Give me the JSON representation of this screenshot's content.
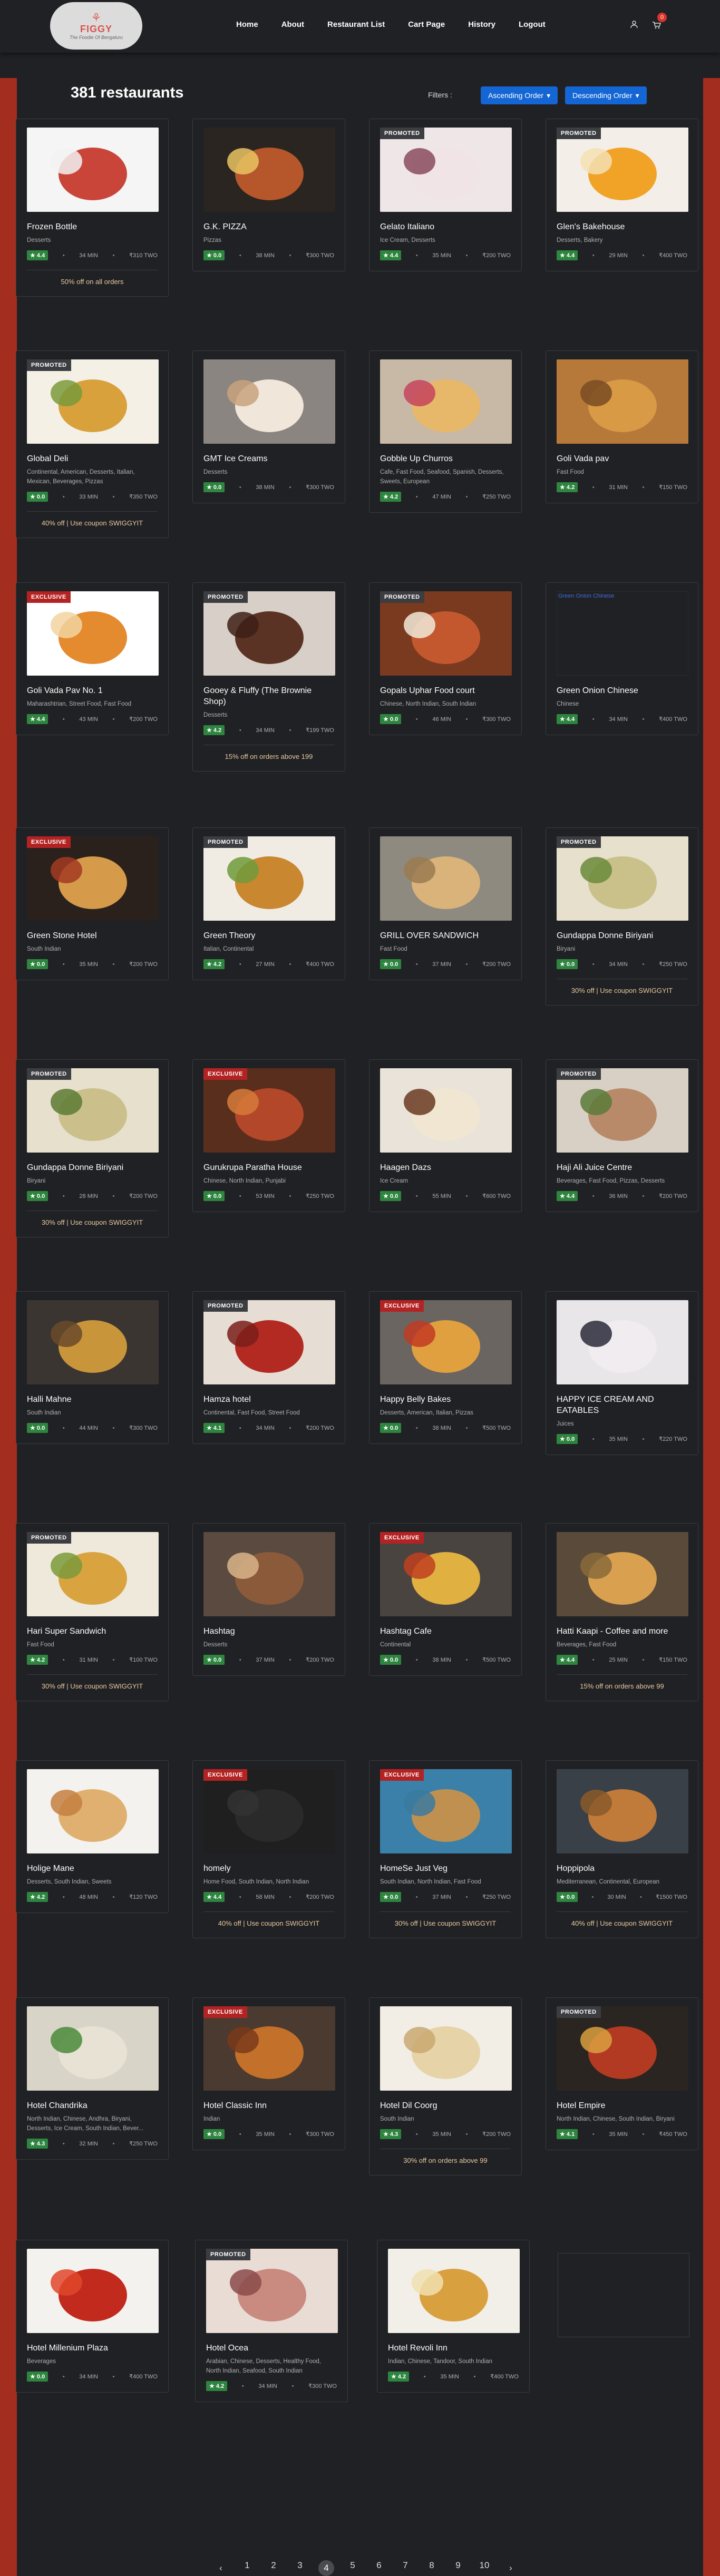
{
  "header": {
    "brand": "FIGGY",
    "tagline": "The Foodie Of Bengaluru",
    "nav": [
      "Home",
      "About",
      "Restaurant List",
      "Cart Page",
      "History",
      "Logout"
    ],
    "cart_count": "0"
  },
  "toolbar": {
    "count": "381 restaurants",
    "filters_label": "Filters :",
    "asc": "Ascending Order",
    "desc": "Descending Order"
  },
  "restaurants": [
    {
      "name": "Frozen Bottle",
      "cuisine": "Desserts",
      "rating": "4.4",
      "time": "34 MIN",
      "cost": "₹310 TWO",
      "tag": "",
      "offer": "50% off on all orders",
      "c1": "#c9453a",
      "c2": "#f2f2f2",
      "bg": "#f5f5f5"
    },
    {
      "name": "G.K. PIZZA",
      "cuisine": "Pizzas",
      "rating": "0.0",
      "time": "38 MIN",
      "cost": "₹300 TWO",
      "tag": "",
      "offer": "",
      "c1": "#b5562b",
      "c2": "#e9c463",
      "bg": "#2a2520"
    },
    {
      "name": "Gelato Italiano",
      "cuisine": "Ice Cream, Desserts",
      "rating": "4.4",
      "time": "35 MIN",
      "cost": "₹200 TWO",
      "tag": "PROMOTED",
      "offer": "",
      "c1": "#f0e4e6",
      "c2": "#8a4b5e",
      "bg": "#efe6e8"
    },
    {
      "name": "Glen's Bakehouse",
      "cuisine": "Desserts, Bakery",
      "rating": "4.4",
      "time": "29 MIN",
      "cost": "₹400 TWO",
      "tag": "PROMOTED",
      "offer": "",
      "c1": "#f0a327",
      "c2": "#f5e1b4",
      "bg": "#f3efe8"
    },
    {
      "name": "Global Deli",
      "cuisine": "Continental, American, Desserts, Italian, Mexican, Beverages, Pizzas",
      "rating": "0.0",
      "time": "33 MIN",
      "cost": "₹350 TWO",
      "tag": "PROMOTED",
      "offer": "40% off | Use coupon SWIGGYIT",
      "c1": "#d8a13b",
      "c2": "#7a9a3c",
      "bg": "#f4f0e5"
    },
    {
      "name": "GMT Ice Creams",
      "cuisine": "Desserts",
      "rating": "0.0",
      "time": "38 MIN",
      "cost": "₹300 TWO",
      "tag": "",
      "offer": "",
      "c1": "#f0e6da",
      "c2": "#c8a27d",
      "bg": "#8a8580"
    },
    {
      "name": "Gobble Up Churros",
      "cuisine": "Cafe, Fast Food, Seafood, Spanish, Desserts, Sweets, European",
      "rating": "4.2",
      "time": "47 MIN",
      "cost": "₹250 TWO",
      "tag": "",
      "offer": "",
      "c1": "#e8b86a",
      "c2": "#c5435c",
      "bg": "#c8b8a6"
    },
    {
      "name": "Goli Vada pav",
      "cuisine": "Fast Food",
      "rating": "4.2",
      "time": "31 MIN",
      "cost": "₹150 TWO",
      "tag": "",
      "offer": "",
      "c1": "#d89a45",
      "c2": "#7a4b23",
      "bg": "#b6793a"
    },
    {
      "name": "Goli Vada Pav No. 1",
      "cuisine": "Maharashtrian, Street Food, Fast Food",
      "rating": "4.4",
      "time": "43 MIN",
      "cost": "₹200 TWO",
      "tag": "EXCLUSIVE",
      "offer": "",
      "c1": "#e48a2f",
      "c2": "#f2d4a0",
      "bg": "#ffffff"
    },
    {
      "name": "Gooey & Fluffy (The Brownie Shop)",
      "cuisine": "Desserts",
      "rating": "4.2",
      "time": "34 MIN",
      "cost": "₹199 TWO",
      "tag": "PROMOTED",
      "offer": "15% off on orders above 199",
      "c1": "#5a3324",
      "c2": "#3e2016",
      "bg": "#d8d0c8"
    },
    {
      "name": "Gopals Uphar Food court",
      "cuisine": "Chinese, North Indian, South Indian",
      "rating": "0.0",
      "time": "46 MIN",
      "cost": "₹300 TWO",
      "tag": "PROMOTED",
      "offer": "",
      "c1": "#c3582f",
      "c2": "#f2ead8",
      "bg": "#7a3a20"
    },
    {
      "name": "Green Onion Chinese",
      "cuisine": "Chinese",
      "rating": "4.4",
      "time": "34 MIN",
      "cost": "₹400 TWO",
      "tag": "",
      "offer": "",
      "c1": "",
      "c2": "",
      "bg": "",
      "broken": "Green Onion Chinese"
    },
    {
      "name": "Green Stone Hotel",
      "cuisine": "South Indian",
      "rating": "0.0",
      "time": "35 MIN",
      "cost": "₹200 TWO",
      "tag": "EXCLUSIVE",
      "offer": "",
      "c1": "#d59a4a",
      "c2": "#a33a22",
      "bg": "#2a211c"
    },
    {
      "name": "Green Theory",
      "cuisine": "Italian, Continental",
      "rating": "4.2",
      "time": "27 MIN",
      "cost": "₹400 TWO",
      "tag": "PROMOTED",
      "offer": "",
      "c1": "#c9872f",
      "c2": "#6e9b3a",
      "bg": "#f0ece4"
    },
    {
      "name": "GRILL OVER SANDWICH",
      "cuisine": "Fast Food",
      "rating": "0.0",
      "time": "37 MIN",
      "cost": "₹200 TWO",
      "tag": "",
      "offer": "",
      "c1": "#d9b37a",
      "c2": "#9a7a50",
      "bg": "#8f8a80"
    },
    {
      "name": "Gundappa Donne Biriyani",
      "cuisine": "Biryani",
      "rating": "0.0",
      "time": "34 MIN",
      "cost": "₹250 TWO",
      "tag": "PROMOTED",
      "offer": "30% off | Use coupon SWIGGYIT",
      "c1": "#c9c08a",
      "c2": "#6a8a3a",
      "bg": "#e6e0cc"
    },
    {
      "name": "Gundappa Donne Biriyani",
      "cuisine": "Biryani",
      "rating": "0.0",
      "time": "28 MIN",
      "cost": "₹200 TWO",
      "tag": "PROMOTED",
      "offer": "30% off | Use coupon SWIGGYIT",
      "c1": "#cbbf8c",
      "c2": "#5c7a33",
      "bg": "#e6e0cc"
    },
    {
      "name": "Gurukrupa Paratha House",
      "cuisine": "Chinese, North Indian, Punjabi",
      "rating": "0.0",
      "time": "53 MIN",
      "cost": "₹250 TWO",
      "tag": "EXCLUSIVE",
      "offer": "",
      "c1": "#b3472a",
      "c2": "#d67a3a",
      "bg": "#5a2e1c"
    },
    {
      "name": "Haagen Dazs",
      "cuisine": "Ice Cream",
      "rating": "0.0",
      "time": "55 MIN",
      "cost": "₹600 TWO",
      "tag": "",
      "offer": "",
      "c1": "#f1e6d2",
      "c2": "#6a3a22",
      "bg": "#e9e3da"
    },
    {
      "name": "Haji Ali Juice Centre",
      "cuisine": "Beverages, Fast Food, Pizzas, Desserts",
      "rating": "4.4",
      "time": "36 MIN",
      "cost": "₹200 TWO",
      "tag": "PROMOTED",
      "offer": "",
      "c1": "#b88a6a",
      "c2": "#5a7a3a",
      "bg": "#d8d0c4"
    },
    {
      "name": "Halli Mahne",
      "cuisine": "South Indian",
      "rating": "0.0",
      "time": "44 MIN",
      "cost": "₹300 TWO",
      "tag": "",
      "offer": "",
      "c1": "#c9953a",
      "c2": "#6a4a2a",
      "bg": "#3a3530"
    },
    {
      "name": "Hamza hotel",
      "cuisine": "Continental, Fast Food, Street Food",
      "rating": "4.1",
      "time": "34 MIN",
      "cost": "₹200 TWO",
      "tag": "PROMOTED",
      "offer": "",
      "c1": "#b32a22",
      "c2": "#7a1f1a",
      "bg": "#e6ddd4"
    },
    {
      "name": "Happy Belly Bakes",
      "cuisine": "Desserts, American, Italian, Pizzas",
      "rating": "0.0",
      "time": "38 MIN",
      "cost": "₹500 TWO",
      "tag": "EXCLUSIVE",
      "offer": "",
      "c1": "#e0a040",
      "c2": "#c23a22",
      "bg": "#6a6560"
    },
    {
      "name": "HAPPY ICE CREAM AND EATABLES",
      "cuisine": "Juices",
      "rating": "0.0",
      "time": "35 MIN",
      "cost": "₹220 TWO",
      "tag": "",
      "offer": "",
      "c1": "#f0ecf0",
      "c2": "#2a2a3a",
      "bg": "#e9e6ea"
    },
    {
      "name": "Hari Super Sandwich",
      "cuisine": "Fast Food",
      "rating": "4.2",
      "time": "31 MIN",
      "cost": "₹100 TWO",
      "tag": "PROMOTED",
      "offer": "30% off | Use coupon SWIGGYIT",
      "c1": "#d9a440",
      "c2": "#7a9a3a",
      "bg": "#efe9dc"
    },
    {
      "name": "Hashtag",
      "cuisine": "Desserts",
      "rating": "0.0",
      "time": "37 MIN",
      "cost": "₹200 TWO",
      "tag": "",
      "offer": "",
      "c1": "#8a5a3a",
      "c2": "#d9b48a",
      "bg": "#5a4a40"
    },
    {
      "name": "Hashtag Cafe",
      "cuisine": "Continental",
      "rating": "0.0",
      "time": "38 MIN",
      "cost": "₹500 TWO",
      "tag": "EXCLUSIVE",
      "offer": "",
      "c1": "#e0b040",
      "c2": "#c04020",
      "bg": "#4a4440"
    },
    {
      "name": "Hatti Kaapi - Coffee and more",
      "cuisine": "Beverages, Fast Food",
      "rating": "4.4",
      "time": "25 MIN",
      "cost": "₹150 TWO",
      "tag": "",
      "offer": "15% off on orders above 99",
      "c1": "#d9a050",
      "c2": "#8a6a3a",
      "bg": "#5a4a3a"
    },
    {
      "name": "Holige Mane",
      "cuisine": "Desserts, South Indian, Sweets",
      "rating": "4.2",
      "time": "48 MIN",
      "cost": "₹120 TWO",
      "tag": "",
      "offer": "",
      "c1": "#e0b070",
      "c2": "#c48040",
      "bg": "#f4f2ee"
    },
    {
      "name": "homely",
      "cuisine": "Home Food, South Indian, North Indian",
      "rating": "4.4",
      "time": "58 MIN",
      "cost": "₹200 TWO",
      "tag": "EXCLUSIVE",
      "offer": "40% off | Use coupon SWIGGYIT",
      "c1": "#2a2a2a",
      "c2": "#333",
      "bg": "#1f1f1f"
    },
    {
      "name": "HomeSe Just Veg",
      "cuisine": "South Indian, North Indian, Fast Food",
      "rating": "0.0",
      "time": "37 MIN",
      "cost": "₹250 TWO",
      "tag": "EXCLUSIVE",
      "offer": "30% off | Use coupon SWIGGYIT",
      "c1": "#c09050",
      "c2": "#3a7aa0",
      "bg": "#3a80a8"
    },
    {
      "name": "Hoppipola",
      "cuisine": "Mediterranean, Continental, European",
      "rating": "0.0",
      "time": "30 MIN",
      "cost": "₹1500 TWO",
      "tag": "",
      "offer": "40% off | Use coupon SWIGGYIT",
      "c1": "#c07a3a",
      "c2": "#8a5a2a",
      "bg": "#3a4048"
    },
    {
      "name": "Hotel Chandrika",
      "cuisine": "North Indian, Chinese, Andhra, Biryani, Desserts, Ice Cream, South Indian, Bever...",
      "rating": "4.3",
      "time": "32 MIN",
      "cost": "₹250 TWO",
      "tag": "",
      "offer": "",
      "c1": "#e8e2d4",
      "c2": "#4a8a3a",
      "bg": "#d9d4c8"
    },
    {
      "name": "Hotel Classic Inn",
      "cuisine": "Indian",
      "rating": "0.0",
      "time": "35 MIN",
      "cost": "₹300 TWO",
      "tag": "EXCLUSIVE",
      "offer": "",
      "c1": "#c2702a",
      "c2": "#7a3a1a",
      "bg": "#4a3a30"
    },
    {
      "name": "Hotel Dil Coorg",
      "cuisine": "South Indian",
      "rating": "4.3",
      "time": "35 MIN",
      "cost": "₹200 TWO",
      "tag": "",
      "offer": "30% off on orders above 99",
      "c1": "#e6d4a8",
      "c2": "#c9a870",
      "bg": "#f2eee6"
    },
    {
      "name": "Hotel Empire",
      "cuisine": "North Indian, Chinese, South Indian, Biryani",
      "rating": "4.1",
      "time": "35 MIN",
      "cost": "₹450 TWO",
      "tag": "PROMOTED",
      "offer": "",
      "c1": "#b33a22",
      "c2": "#d9a040",
      "bg": "#2a2520"
    },
    {
      "name": "Hotel Millenium Plaza",
      "cuisine": "Beverages",
      "rating": "0.0",
      "time": "34 MIN",
      "cost": "₹400 TWO",
      "tag": "",
      "offer": "",
      "c1": "#c22a1e",
      "c2": "#e0462a",
      "bg": "#f4f2ee"
    },
    {
      "name": "Hotel Ocea",
      "cuisine": "Arabian, Chinese, Desserts, Healthy Food, North Indian, Seafood, South Indian",
      "rating": "4.2",
      "time": "34 MIN",
      "cost": "₹300 TWO",
      "tag": "PROMOTED",
      "offer": "",
      "c1": "#c98a80",
      "c2": "#8a4a4a",
      "bg": "#e8dcd4"
    },
    {
      "name": "Hotel Revoli Inn",
      "cuisine": "Indian, Chinese, Tandoor, South Indian",
      "rating": "4.2",
      "time": "35 MIN",
      "cost": "₹400 TWO",
      "tag": "",
      "offer": "",
      "c1": "#d9a040",
      "c2": "#f0e0b0",
      "bg": "#f2efe8"
    }
  ],
  "pagination": {
    "prev": "‹",
    "next": "›",
    "pages": [
      "1",
      "2",
      "3",
      "4",
      "5",
      "6",
      "7",
      "8",
      "9",
      "10"
    ],
    "active": "4"
  }
}
